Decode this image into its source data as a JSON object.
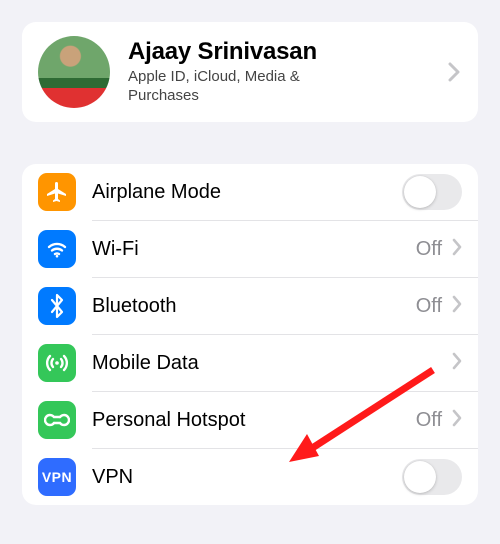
{
  "profile": {
    "name": "Ajaay Srinivasan",
    "subtitle": "Apple ID, iCloud, Media & Purchases"
  },
  "rows": {
    "airplane": {
      "label": "Airplane Mode",
      "toggle": "off"
    },
    "wifi": {
      "label": "Wi-Fi",
      "value": "Off"
    },
    "bluetooth": {
      "label": "Bluetooth",
      "value": "Off"
    },
    "mobile": {
      "label": "Mobile Data"
    },
    "hotspot": {
      "label": "Personal Hotspot",
      "value": "Off"
    },
    "vpn": {
      "label": "VPN",
      "badge": "VPN",
      "toggle": "off"
    }
  },
  "colors": {
    "orange": "#ff9500",
    "blue": "#007aff",
    "green": "#34c759",
    "vpn": "#2f6cff"
  }
}
